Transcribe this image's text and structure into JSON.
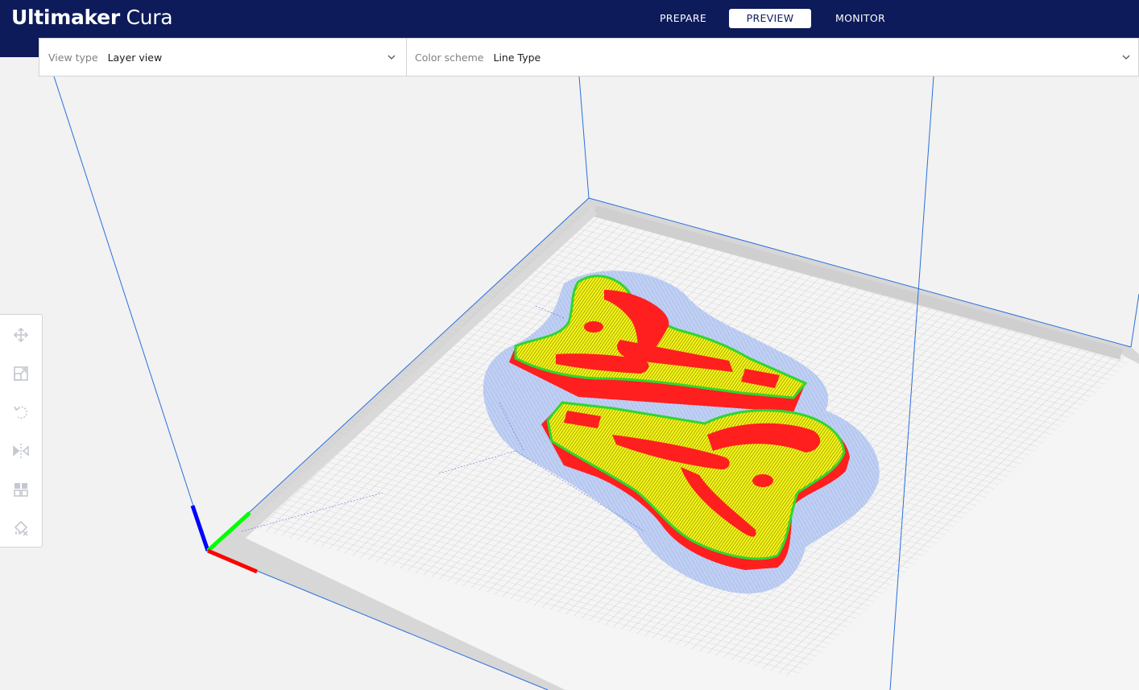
{
  "app": {
    "brand": "Ultimaker",
    "product": "Cura"
  },
  "stages": [
    {
      "label": "PREPARE",
      "active": false
    },
    {
      "label": "PREVIEW",
      "active": true
    },
    {
      "label": "MONITOR",
      "active": false
    }
  ],
  "view_bar": {
    "view_type": {
      "label": "View type",
      "value": "Layer view"
    },
    "color_scheme": {
      "label": "Color scheme",
      "value": "Line Type"
    }
  },
  "toolbar": {
    "tools": [
      {
        "name": "move-tool",
        "icon": "move-icon"
      },
      {
        "name": "scale-tool",
        "icon": "scale-icon"
      },
      {
        "name": "rotate-tool",
        "icon": "rotate-icon"
      },
      {
        "name": "mirror-tool",
        "icon": "mirror-icon"
      },
      {
        "name": "per-model-settings-tool",
        "icon": "per-model-settings-icon"
      },
      {
        "name": "support-blocker-tool",
        "icon": "support-blocker-icon"
      }
    ]
  },
  "colors": {
    "header": "#0e1b5a",
    "wall_outer": "#ff1f1f",
    "wall_inner": "#3fe23f",
    "skin": "#ffff1e",
    "support": "#a9bff2",
    "build_volume": "#2a6fdc",
    "axis_x": "#ff0000",
    "axis_y": "#00ff00",
    "axis_z": "#0000ff"
  }
}
